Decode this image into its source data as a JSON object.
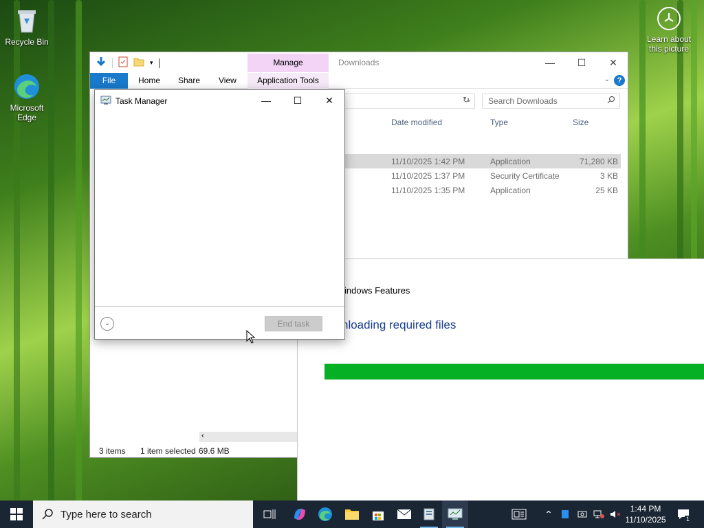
{
  "desktop": {
    "icons": [
      {
        "label": "Recycle Bin"
      },
      {
        "label": "Microsoft Edge"
      }
    ],
    "learn_label": "Learn about this picture"
  },
  "explorer": {
    "tab_manage": "Manage",
    "caption": "Downloads",
    "tabs": [
      "File",
      "Home",
      "Share",
      "View",
      "Application Tools"
    ],
    "search_placeholder": "Search Downloads",
    "columns": [
      "Date modified",
      "Type",
      "Size"
    ],
    "rows": [
      {
        "date": "11/10/2025 1:42 PM",
        "type": "Application",
        "size": "71,280 KB",
        "selected": true
      },
      {
        "date": "11/10/2025 1:37 PM",
        "type": "Security Certificate",
        "size": "3 KB",
        "selected": false
      },
      {
        "date": "11/10/2025 1:35 PM",
        "type": "Application",
        "size": "25 KB",
        "selected": false
      }
    ],
    "status": {
      "items": "3 items",
      "selected": "1 item selected",
      "size": "69.6 MB"
    }
  },
  "features": {
    "title": "indows Features",
    "heading": "nloading required files",
    "progress": 1.0,
    "progress_color": "#06b025"
  },
  "task_manager": {
    "title": "Task Manager",
    "end_task": "End task"
  },
  "taskbar": {
    "search_placeholder": "Type here to search",
    "time": "1:44 PM",
    "date": "11/10/2025",
    "notification_count": "1"
  },
  "colors": {
    "accent": "#1979ca",
    "taskbar": "#1b2635"
  }
}
